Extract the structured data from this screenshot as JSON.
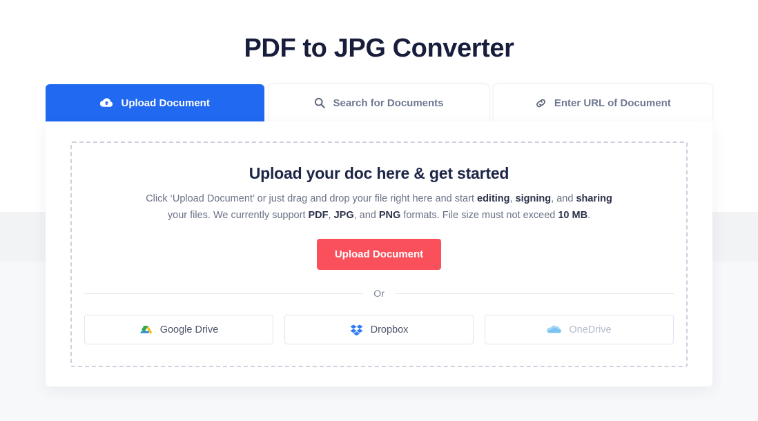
{
  "page": {
    "title": "PDF to JPG Converter",
    "background_color": "#f7f8fa",
    "band_color": "#f2f3f5"
  },
  "tabs": [
    {
      "label": "Upload Document",
      "icon": "cloud-upload-icon",
      "state": "active",
      "accent": "#2069f0"
    },
    {
      "label": "Search for Documents",
      "icon": "search-icon",
      "state": "inactive"
    },
    {
      "label": "Enter URL of Document",
      "icon": "link-icon",
      "state": "inactive"
    }
  ],
  "drop_zone": {
    "heading": "Upload your doc here & get started",
    "description": {
      "line1_part1": "Click ‘Upload Document’ or just drag and drop your file right here and start ",
      "line1_bold1": "editing",
      "line1_part2": ", ",
      "line1_bold2": "signing",
      "line1_part3": ", and ",
      "line1_bold3": "sharing",
      "line2_part1": " your files. We currently support ",
      "line2_bold1": "PDF",
      "line2_part2": ", ",
      "line2_bold2": "JPG",
      "line2_part3": ", and ",
      "line2_bold3": "PNG",
      "line2_part4": " formats. File size must not exceed ",
      "line2_bold4": "10 MB",
      "line2_part5": "."
    },
    "upload_button": {
      "label": "Upload Document",
      "color": "#f9505b"
    },
    "or_label": "Or",
    "providers": [
      {
        "label": "Google Drive",
        "icon": "google-drive-icon",
        "state": "enabled"
      },
      {
        "label": "Dropbox",
        "icon": "dropbox-icon",
        "state": "enabled"
      },
      {
        "label": "OneDrive",
        "icon": "onedrive-icon",
        "state": "disabled"
      }
    ]
  }
}
